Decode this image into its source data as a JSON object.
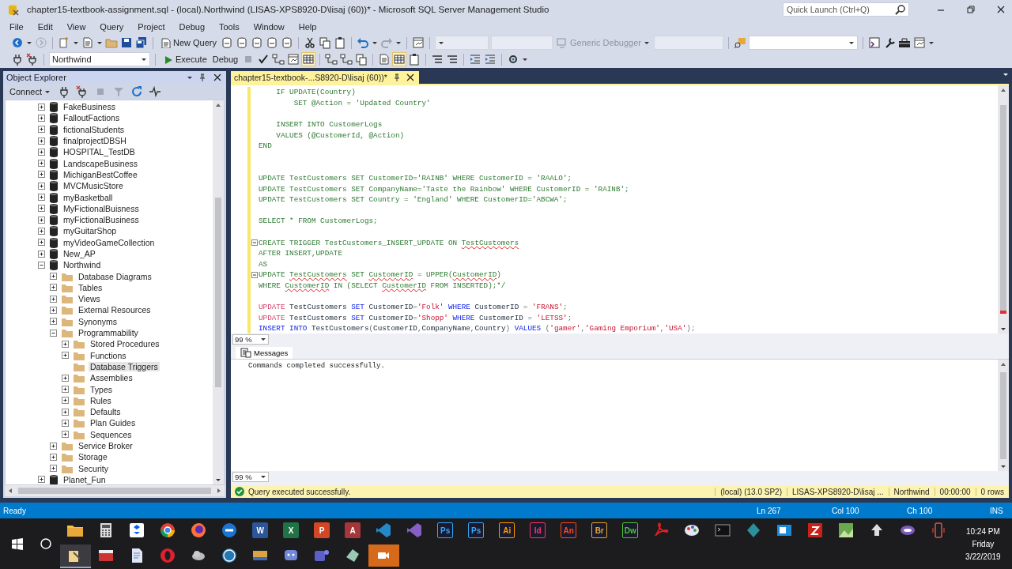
{
  "window": {
    "title": "chapter15-textbook-assignment.sql - (local).Northwind (LISAS-XPS8920-D\\lisaj (60))* - Microsoft SQL Server Management Studio",
    "quick_launch": {
      "placeholder": "Quick Launch (Ctrl+Q)"
    }
  },
  "menu": [
    "File",
    "Edit",
    "View",
    "Query",
    "Project",
    "Debug",
    "Tools",
    "Window",
    "Help"
  ],
  "toolbar": {
    "new_query": "New Query",
    "debugger": "Generic Debugger",
    "database": "Northwind",
    "execute": "Execute",
    "debug": "Debug"
  },
  "object_explorer": {
    "title": "Object Explorer",
    "connect": "Connect",
    "tree": [
      {
        "label": "FakeBusiness",
        "kind": "database",
        "expandable": true,
        "expanded": false,
        "selected": false
      },
      {
        "label": "FalloutFactions",
        "kind": "database",
        "expandable": true,
        "expanded": false,
        "selected": false
      },
      {
        "label": "fictionalStudents",
        "kind": "database",
        "expandable": true,
        "expanded": false,
        "selected": false
      },
      {
        "label": "finalprojectDBSH",
        "kind": "database",
        "expandable": true,
        "expanded": false,
        "selected": false
      },
      {
        "label": "HOSPITAL_TestDB",
        "kind": "database",
        "expandable": true,
        "expanded": false,
        "selected": false
      },
      {
        "label": "LandscapeBusiness",
        "kind": "database",
        "expandable": true,
        "expanded": false,
        "selected": false
      },
      {
        "label": "MichiganBestCoffee",
        "kind": "database",
        "expandable": true,
        "expanded": false,
        "selected": false
      },
      {
        "label": "MVCMusicStore",
        "kind": "database",
        "expandable": true,
        "expanded": false,
        "selected": false
      },
      {
        "label": "myBasketball",
        "kind": "database",
        "expandable": true,
        "expanded": false,
        "selected": false
      },
      {
        "label": "MyFictionalBuisness",
        "kind": "database",
        "expandable": true,
        "expanded": false,
        "selected": false
      },
      {
        "label": "myFictionalBusiness",
        "kind": "database",
        "expandable": true,
        "expanded": false,
        "selected": false
      },
      {
        "label": "myGuitarShop",
        "kind": "database",
        "expandable": true,
        "expanded": false,
        "selected": false
      },
      {
        "label": "myVideoGameCollection",
        "kind": "database",
        "expandable": true,
        "expanded": false,
        "selected": false
      },
      {
        "label": "New_AP",
        "kind": "database",
        "expandable": true,
        "expanded": false,
        "selected": false
      },
      {
        "label": "Northwind",
        "kind": "database",
        "expandable": true,
        "expanded": true,
        "selected": false,
        "children": [
          {
            "label": "Database Diagrams",
            "kind": "folder",
            "expandable": true,
            "expanded": false,
            "selected": false
          },
          {
            "label": "Tables",
            "kind": "folder",
            "expandable": true,
            "expanded": false,
            "selected": false
          },
          {
            "label": "Views",
            "kind": "folder",
            "expandable": true,
            "expanded": false,
            "selected": false
          },
          {
            "label": "External Resources",
            "kind": "folder",
            "expandable": true,
            "expanded": false,
            "selected": false
          },
          {
            "label": "Synonyms",
            "kind": "folder",
            "expandable": true,
            "expanded": false,
            "selected": false
          },
          {
            "label": "Programmability",
            "kind": "folder",
            "expandable": true,
            "expanded": true,
            "selected": false,
            "children": [
              {
                "label": "Stored Procedures",
                "kind": "folder",
                "expandable": true,
                "expanded": false,
                "selected": false
              },
              {
                "label": "Functions",
                "kind": "folder",
                "expandable": true,
                "expanded": false,
                "selected": false
              },
              {
                "label": "Database Triggers",
                "kind": "folder",
                "expandable": false,
                "selected": true
              },
              {
                "label": "Assemblies",
                "kind": "folder",
                "expandable": true,
                "expanded": false,
                "selected": false
              },
              {
                "label": "Types",
                "kind": "folder",
                "expandable": true,
                "expanded": false,
                "selected": false
              },
              {
                "label": "Rules",
                "kind": "folder",
                "expandable": true,
                "expanded": false,
                "selected": false
              },
              {
                "label": "Defaults",
                "kind": "folder",
                "expandable": true,
                "expanded": false,
                "selected": false
              },
              {
                "label": "Plan Guides",
                "kind": "folder",
                "expandable": true,
                "expanded": false,
                "selected": false
              },
              {
                "label": "Sequences",
                "kind": "folder",
                "expandable": true,
                "expanded": false,
                "selected": false
              }
            ]
          },
          {
            "label": "Service Broker",
            "kind": "folder",
            "expandable": true,
            "expanded": false,
            "selected": false
          },
          {
            "label": "Storage",
            "kind": "folder",
            "expandable": true,
            "expanded": false,
            "selected": false
          },
          {
            "label": "Security",
            "kind": "folder",
            "expandable": true,
            "expanded": false,
            "selected": false
          }
        ]
      },
      {
        "label": "Planet_Fun",
        "kind": "database",
        "expandable": true,
        "expanded": false,
        "selected": false
      }
    ]
  },
  "editor": {
    "tab": {
      "title": "chapter15-textbook-...S8920-D\\lisaj (60))*",
      "selected": true
    },
    "zoom": "99 %",
    "lines": [
      {
        "kind": "code",
        "fold": false,
        "segments": [
          {
            "text": "    IF UPDATE(Country)",
            "kind": "comment"
          }
        ]
      },
      {
        "kind": "code",
        "fold": false,
        "segments": [
          {
            "text": "        SET @Action = 'Updated Country'",
            "kind": "comment"
          }
        ]
      },
      {
        "kind": "blank"
      },
      {
        "kind": "code",
        "fold": false,
        "segments": [
          {
            "text": "    INSERT INTO CustomerLogs",
            "kind": "comment"
          }
        ]
      },
      {
        "kind": "code",
        "fold": false,
        "segments": [
          {
            "text": "    VALUES (@CustomerId, @Action)",
            "kind": "comment"
          }
        ]
      },
      {
        "kind": "code",
        "fold": false,
        "segments": [
          {
            "text": "END",
            "kind": "comment"
          }
        ]
      },
      {
        "kind": "blank"
      },
      {
        "kind": "blank"
      },
      {
        "kind": "code",
        "fold": false,
        "segments": [
          {
            "text": "UPDATE TestCustomers SET CustomerID='RAINB' WHERE CustomerID = 'RAALO';",
            "kind": "comment"
          }
        ]
      },
      {
        "kind": "code",
        "fold": false,
        "segments": [
          {
            "text": "UPDATE TestCustomers SET CompanyName='Taste the Rainbow' WHERE CustomerID = 'RAINB';",
            "kind": "comment"
          }
        ]
      },
      {
        "kind": "code",
        "fold": false,
        "segments": [
          {
            "text": "UPDATE TestCustomers SET Country = 'England' WHERE CustomerID='ABCWA';",
            "kind": "comment"
          }
        ]
      },
      {
        "kind": "blank"
      },
      {
        "kind": "code",
        "fold": false,
        "segments": [
          {
            "text": "SELECT * FROM CustomerLogs;",
            "kind": "comment"
          }
        ]
      },
      {
        "kind": "blank"
      },
      {
        "kind": "code",
        "fold": true,
        "segments": [
          {
            "text": "CREATE TRIGGER TestCustomers_INSERT_UPDATE ON ",
            "kind": "comment"
          },
          {
            "text": "TestCustomers",
            "kind": "comment-error"
          }
        ]
      },
      {
        "kind": "code",
        "fold": false,
        "segments": [
          {
            "text": "AFTER INSERT,UPDATE",
            "kind": "comment"
          }
        ]
      },
      {
        "kind": "code",
        "fold": false,
        "segments": [
          {
            "text": "AS",
            "kind": "comment"
          }
        ]
      },
      {
        "kind": "code",
        "fold": true,
        "segments": [
          {
            "text": "UPDATE ",
            "kind": "comment"
          },
          {
            "text": "TestCustomers",
            "kind": "comment-error"
          },
          {
            "text": " SET ",
            "kind": "comment"
          },
          {
            "text": "CustomerID",
            "kind": "comment-error"
          },
          {
            "text": " = UPPER(",
            "kind": "comment"
          },
          {
            "text": "CustomerID",
            "kind": "comment-error"
          },
          {
            "text": ")",
            "kind": "comment"
          }
        ]
      },
      {
        "kind": "code",
        "fold": false,
        "segments": [
          {
            "text": "WHERE ",
            "kind": "comment"
          },
          {
            "text": "CustomerID",
            "kind": "comment-error"
          },
          {
            "text": " IN (SELECT ",
            "kind": "comment"
          },
          {
            "text": "CustomerID",
            "kind": "comment-error"
          },
          {
            "text": " FROM INSERTED);*/",
            "kind": "comment"
          }
        ]
      },
      {
        "kind": "blank"
      },
      {
        "kind": "code",
        "fold": false,
        "segments": [
          {
            "text": "UPDATE",
            "kind": "function"
          },
          {
            "text": " TestCustomers ",
            "kind": "plain"
          },
          {
            "text": "SET",
            "kind": "keyword"
          },
          {
            "text": " CustomerID",
            "kind": "plain"
          },
          {
            "text": "=",
            "kind": "operator"
          },
          {
            "text": "'Folk'",
            "kind": "string"
          },
          {
            "text": " WHERE",
            "kind": "keyword"
          },
          {
            "text": " CustomerID ",
            "kind": "plain"
          },
          {
            "text": "=",
            "kind": "operator"
          },
          {
            "text": " 'FRANS'",
            "kind": "string"
          },
          {
            "text": ";",
            "kind": "operator"
          }
        ]
      },
      {
        "kind": "code",
        "fold": false,
        "segments": [
          {
            "text": "UPDATE",
            "kind": "function"
          },
          {
            "text": " TestCustomers ",
            "kind": "plain"
          },
          {
            "text": "SET",
            "kind": "keyword"
          },
          {
            "text": " CustomerID",
            "kind": "plain"
          },
          {
            "text": "=",
            "kind": "operator"
          },
          {
            "text": "'Shopp'",
            "kind": "string"
          },
          {
            "text": " WHERE",
            "kind": "keyword"
          },
          {
            "text": " CustomerID ",
            "kind": "plain"
          },
          {
            "text": "=",
            "kind": "operator"
          },
          {
            "text": " 'LETSS'",
            "kind": "string"
          },
          {
            "text": ";",
            "kind": "operator"
          }
        ]
      },
      {
        "kind": "code",
        "fold": false,
        "segments": [
          {
            "text": "INSERT INTO",
            "kind": "keyword"
          },
          {
            "text": " TestCustomers",
            "kind": "plain"
          },
          {
            "text": "(",
            "kind": "operator"
          },
          {
            "text": "CustomerID",
            "kind": "plain"
          },
          {
            "text": ",",
            "kind": "operator"
          },
          {
            "text": "CompanyName",
            "kind": "plain"
          },
          {
            "text": ",",
            "kind": "operator"
          },
          {
            "text": "Country",
            "kind": "plain"
          },
          {
            "text": ")",
            "kind": "operator"
          },
          {
            "text": " VALUES ",
            "kind": "keyword"
          },
          {
            "text": "(",
            "kind": "operator"
          },
          {
            "text": "'gamer'",
            "kind": "string"
          },
          {
            "text": ",",
            "kind": "operator"
          },
          {
            "text": "'Gaming Emporium'",
            "kind": "string"
          },
          {
            "text": ",",
            "kind": "operator"
          },
          {
            "text": "'USA'",
            "kind": "string"
          },
          {
            "text": ");",
            "kind": "operator"
          }
        ]
      }
    ]
  },
  "results": {
    "tabs": [
      {
        "label": "Messages",
        "selected": true
      }
    ],
    "message": "Commands completed successfully.",
    "zoom": "99 %"
  },
  "query_status": {
    "message": "Query executed successfully.",
    "server": "(local) (13.0 SP2)",
    "user": "LISAS-XPS8920-D\\lisaj ...",
    "database": "Northwind",
    "elapsed": "00:00:00",
    "rows": "0 rows"
  },
  "status_bar": {
    "state": "Ready",
    "line": "Ln 267",
    "column": "Col 100",
    "character": "Ch 100",
    "mode": "INS"
  },
  "taskbar": {
    "labels": [
      "W",
      "X",
      "P",
      "A",
      "Ps",
      "Ps",
      "Ai",
      "Id",
      "An",
      "Br",
      "Dw"
    ],
    "time": "10:24 PM",
    "day": "Friday",
    "date": "3/22/2019"
  }
}
